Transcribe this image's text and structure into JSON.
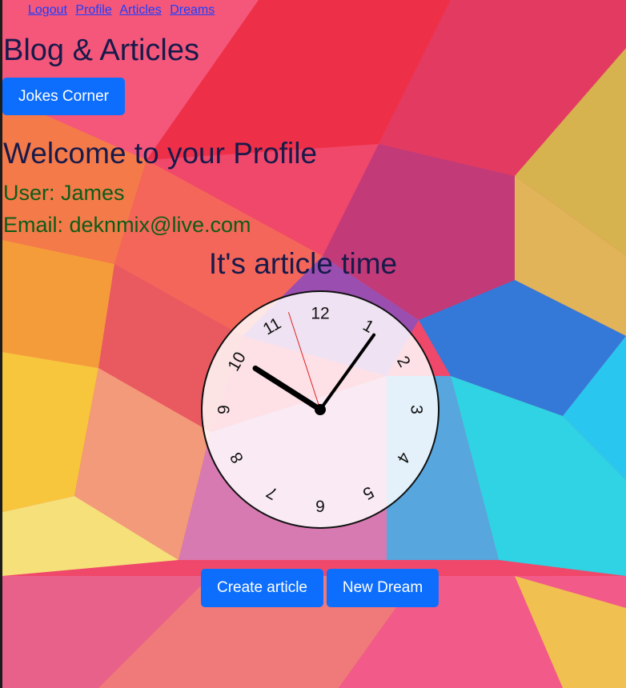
{
  "nav": {
    "links": [
      {
        "label": "Logout"
      },
      {
        "label": "Profile"
      },
      {
        "label": "Articles"
      },
      {
        "label": "Dreams"
      }
    ]
  },
  "page": {
    "title": "Blog & Articles",
    "jokes_button": "Jokes Corner"
  },
  "profile": {
    "heading": "Welcome to your Profile",
    "user_text": "User: James",
    "email_text": "Email: deknmix@live.com"
  },
  "clock": {
    "heading": "It's article time",
    "numerals": [
      "12",
      "1",
      "2",
      "3",
      "4",
      "5",
      "6",
      "7",
      "8",
      "9",
      "10",
      "11"
    ],
    "time": {
      "hour": 10,
      "minute": 5,
      "second": 57
    }
  },
  "actions": {
    "create_label": "Create article",
    "dream_label": "New Dream"
  },
  "colors": {
    "button": "#0d6efd",
    "heading": "#171a4a",
    "info": "#0d5c16",
    "link": "#1a3fff",
    "second_hand": "#e02020"
  }
}
